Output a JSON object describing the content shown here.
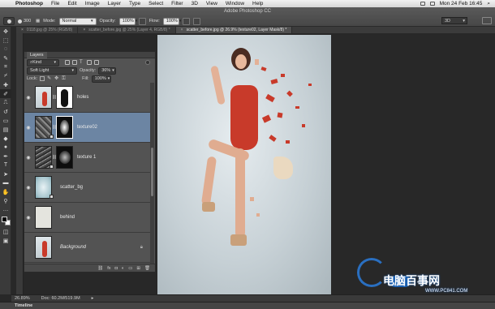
{
  "menubar": {
    "app": "Photoshop",
    "items": [
      "File",
      "Edit",
      "Image",
      "Layer",
      "Type",
      "Select",
      "Filter",
      "3D",
      "View",
      "Window",
      "Help"
    ],
    "clock": "Mon 24 Feb  16:45"
  },
  "window": {
    "title": "Adobe Photoshop CC"
  },
  "options": {
    "mode_label": "Mode:",
    "mode_value": "Normal",
    "opacity_label": "Opacity:",
    "opacity_value": "100%",
    "flow_label": "Flow:",
    "flow_value": "100%",
    "brush_size": "300",
    "workspace": "3D"
  },
  "tabs": [
    {
      "label": "0118.jpg @ 25% (RGB/8)"
    },
    {
      "label": "scatter_before.jpg @ 25% (Layer 4, RGB/8) *"
    },
    {
      "label": "scatter_before.jpg @ 26.9% (texture02, Layer Mask/8) *"
    }
  ],
  "layers_panel": {
    "tab": "Layers",
    "filter": "Kind",
    "blend_mode": "Soft Light",
    "opacity_label": "Opacity:",
    "opacity_value": "36%",
    "lock_label": "Lock:",
    "fill_label": "Fill:",
    "fill_value": "100%",
    "layers": [
      {
        "name": "holes",
        "visible": true,
        "selected": false,
        "has_mask": true
      },
      {
        "name": "texture02",
        "visible": true,
        "selected": true,
        "has_mask": true
      },
      {
        "name": "texture 1",
        "visible": true,
        "selected": false,
        "has_mask": true
      },
      {
        "name": "scatter_bg",
        "visible": true,
        "selected": false,
        "has_mask": false
      },
      {
        "name": "behind",
        "visible": true,
        "selected": false,
        "has_mask": false
      },
      {
        "name": "Background",
        "visible": false,
        "selected": false,
        "has_mask": false,
        "locked": true
      }
    ]
  },
  "status": {
    "zoom": "26.89%",
    "doc": "Doc: 60.2M/519.9M"
  },
  "timeline": {
    "label": "Timeline"
  },
  "watermark": {
    "text": "电脑百事网",
    "url": "WWW.PC841.COM"
  },
  "colors": {
    "selection": "#6c85a3",
    "panel": "#535353",
    "dress": "#c83a2a"
  }
}
